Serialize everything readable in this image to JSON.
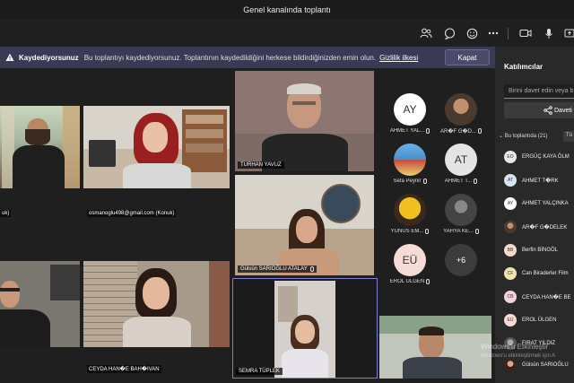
{
  "window": {
    "title": "Genel kanalında toplantı"
  },
  "toolbar": {
    "icons": [
      "people-icon",
      "chat-icon",
      "reactions-icon",
      "more-icon",
      "camera-icon",
      "mic-icon",
      "share-icon"
    ]
  },
  "banner": {
    "heading": "Kaydediyorsunuz",
    "text": "Bu toplantıyı kaydediyorsunuz. Toplantının kaydedildiğini herkese bildirdiğinizden emin olun.",
    "link": "Gizlilik ilkesi",
    "close_label": "Kapat"
  },
  "stage": {
    "tiles": [
      {
        "id": "t1",
        "name": "uk)",
        "mic": false
      },
      {
        "id": "t2",
        "name": "",
        "mic": false
      },
      {
        "id": "t3",
        "name": "osmanoglu498@gmail.com (Konuk)",
        "mic": false
      },
      {
        "id": "t4",
        "name": "TURHAN YAVUZ",
        "mic": false
      },
      {
        "id": "t5",
        "name": "Gülsün SARIOĞLU ATALAY",
        "mic": true
      },
      {
        "id": "t6",
        "name": "",
        "mic": false
      },
      {
        "id": "t7",
        "name": "CEYDA HAN�E BAH�IVAN",
        "mic": false
      },
      {
        "id": "t8",
        "name": "SEMRA TÜPLEK",
        "mic": false
      },
      {
        "id": "t9",
        "name": "",
        "mic": false
      }
    ],
    "avatars": [
      {
        "initials": "AY",
        "label": "AHMET YAL...",
        "color": "#ffffff",
        "photo": false
      },
      {
        "initials": "",
        "label": "AR�F G�D...",
        "color": "#8a6d4e",
        "photo": true
      },
      {
        "initials": "",
        "label": "Sefa Peynir",
        "color": "#4a90c8",
        "photo": true
      },
      {
        "initials": "AT",
        "label": "AHMET T...",
        "color": "#e4e4e4",
        "photo": false
      },
      {
        "initials": "",
        "label": "YUNUS EM...",
        "color": "#f0c020",
        "photo": true
      },
      {
        "initials": "",
        "label": "YAHYA KE...",
        "color": "#666666",
        "photo": true
      },
      {
        "initials": "EÜ",
        "label": "EROL ÜLGEN",
        "color": "#f6dcd6",
        "photo": false
      },
      {
        "initials": "+6",
        "label": "",
        "color": "#3c3c3c",
        "photo": false
      }
    ]
  },
  "panel": {
    "title": "Katılımcılar",
    "invite_placeholder": "Birini davet edin veya b",
    "share_label": "Daveti",
    "section_label": "Bu toplantıda (21)",
    "section_button": "Tü",
    "participants": [
      {
        "initials": "EO",
        "name": "ERGÜÇ KAYA ÖLM",
        "color": "#e8e8e8"
      },
      {
        "initials": "AT",
        "name": "AHMET T�RK",
        "color": "#d8e4f0"
      },
      {
        "initials": "AY",
        "name": "AHMET YALÇINKA",
        "color": "#ffffff"
      },
      {
        "initials": "",
        "name": "AR�F G�DELEK",
        "color": "#8a6d4e"
      },
      {
        "initials": "BB",
        "name": "Berfin BİNGÖL",
        "color": "#f4d9d0"
      },
      {
        "initials": "CF",
        "name": "Can Biraderler Film",
        "color": "#f3e3b0"
      },
      {
        "initials": "CB",
        "name": "CEYDA HAN�E BE",
        "color": "#f1d2e0"
      },
      {
        "initials": "EÜ",
        "name": "EROL ÜLGEN",
        "color": "#f6dcd6"
      },
      {
        "initials": "",
        "name": "FIRAT YILDIZ",
        "color": "#777777"
      },
      {
        "initials": "",
        "name": "Gülsün SARIOĞLU",
        "color": "#b08060"
      }
    ]
  },
  "watermark": {
    "line1": "Windows'u Etkinleştir",
    "line2": "Windows'u etkinleştirmek için A"
  }
}
